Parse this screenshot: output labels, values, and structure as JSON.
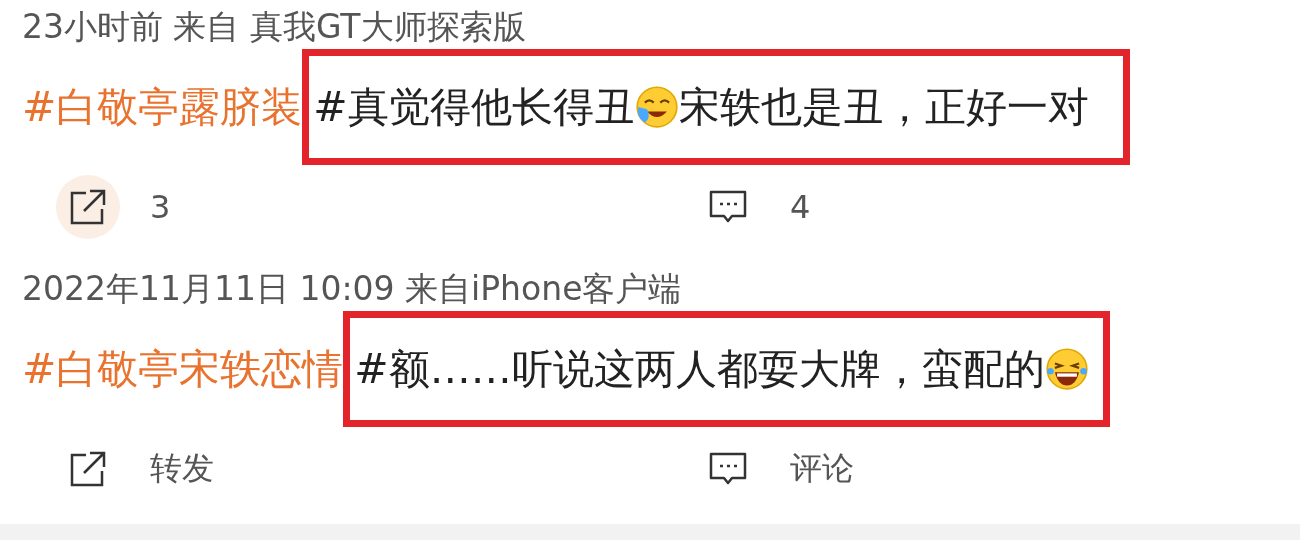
{
  "posts": [
    {
      "meta": "23小时前  来自 真我GT大师探索版",
      "hashtag": "#白敬亭露脐装",
      "content": [
        {
          "kind": "text",
          "text": "#真觉得他长得丑"
        },
        {
          "kind": "crying"
        },
        {
          "kind": "text",
          "text": "宋轶也是丑，正好一对"
        }
      ],
      "actions": [
        {
          "kind": "share",
          "label": "3",
          "pressed": true
        },
        {
          "kind": "comment",
          "label": "4",
          "pressed": false
        }
      ]
    },
    {
      "meta": "2022年11月11日 10:09 来自iPhone客户端",
      "hashtag": "#白敬亭宋轶恋情",
      "content": [
        {
          "kind": "text",
          "text": "#额……听说这两人都耍大牌，蛮配的"
        },
        {
          "kind": "laughing"
        }
      ],
      "actions": [
        {
          "kind": "share",
          "label": "转发",
          "pressed": false
        },
        {
          "kind": "comment",
          "label": "评论",
          "pressed": false
        }
      ]
    }
  ]
}
